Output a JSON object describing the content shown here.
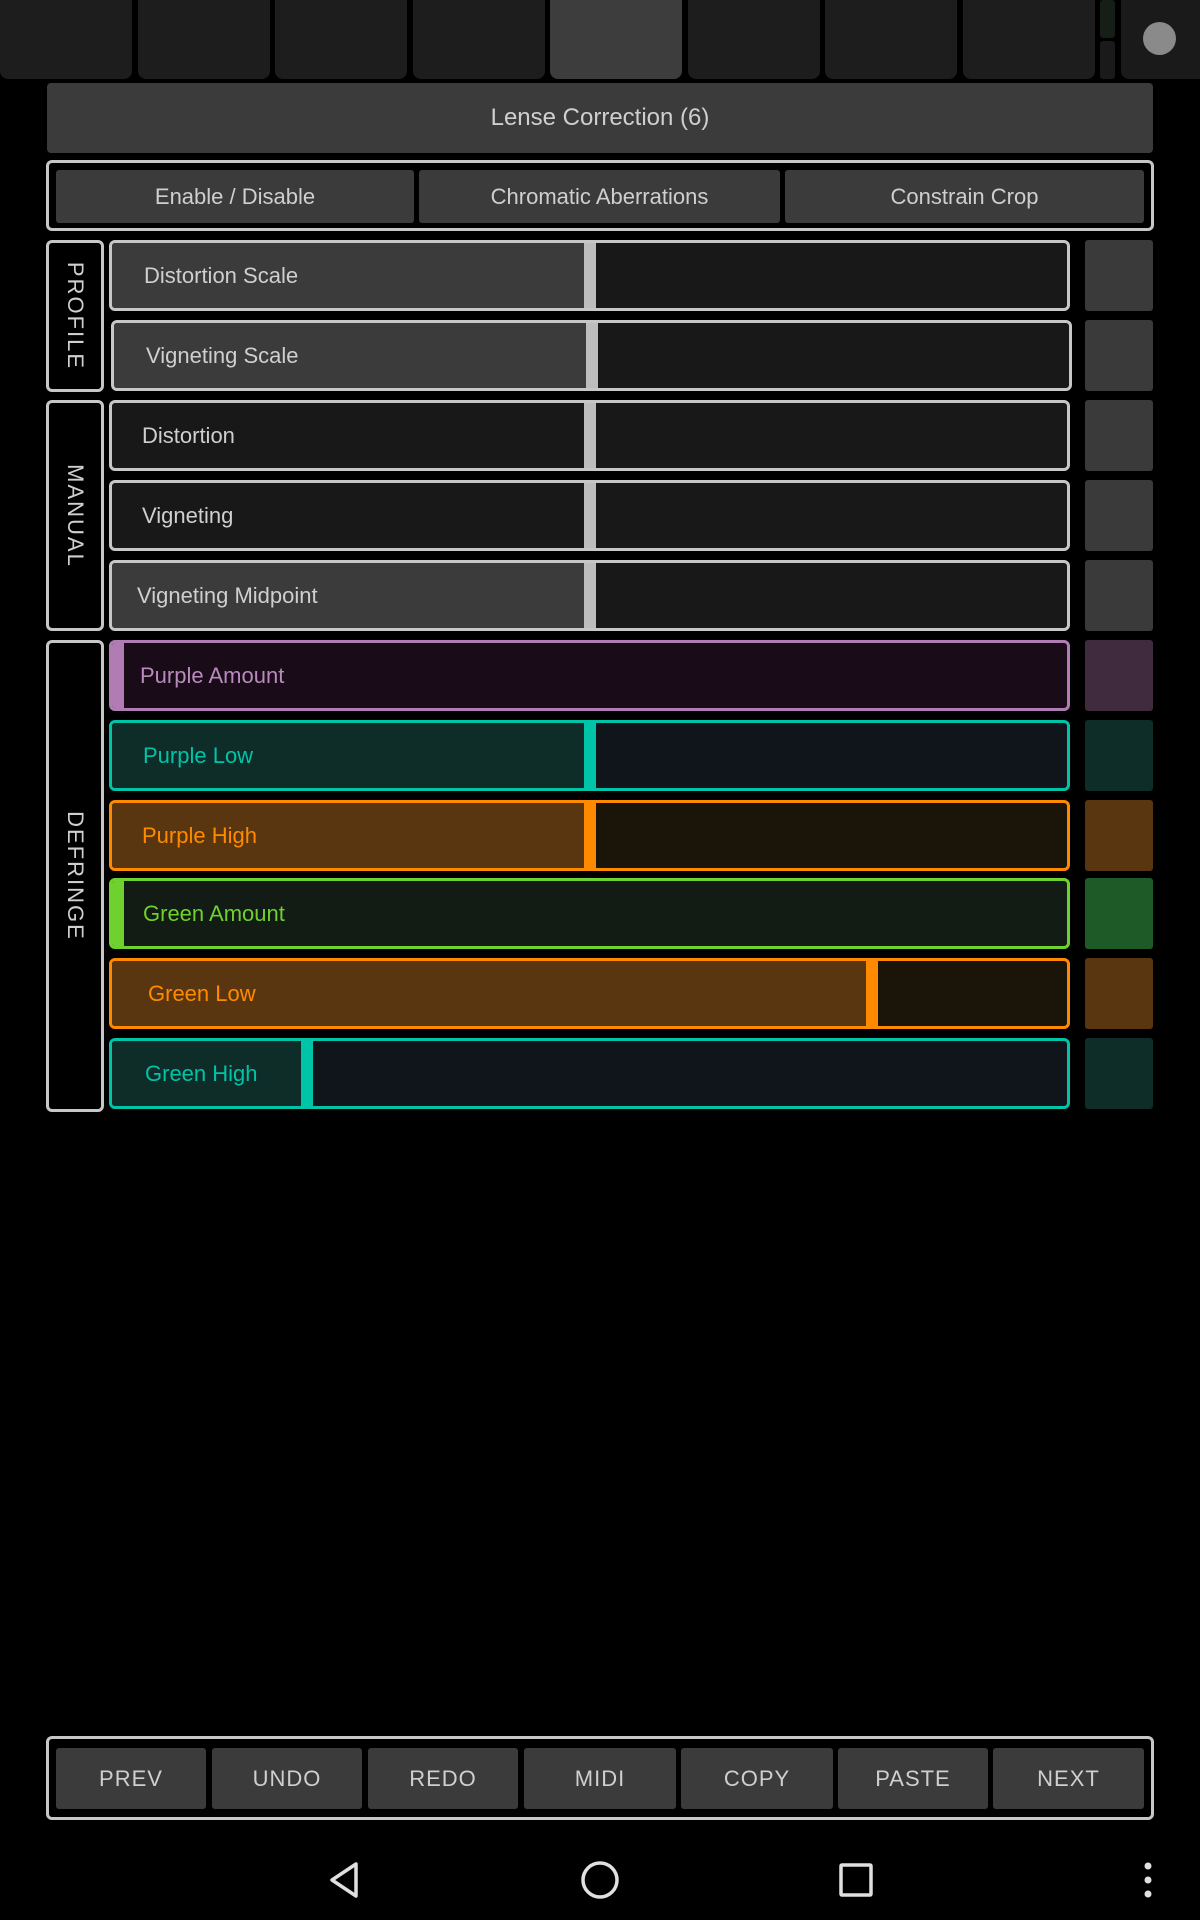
{
  "top_tabs": {
    "count": 8,
    "active_index": 4
  },
  "title": "Lense Correction (6)",
  "mode_buttons": [
    "Enable / Disable",
    "Chromatic Aberrations",
    "Constrain Crop"
  ],
  "groups": [
    {
      "label": "PROFILE"
    },
    {
      "label": "MANUAL"
    },
    {
      "label": "DEFRINGE"
    }
  ],
  "sliders": [
    {
      "label": "Distortion Scale",
      "value": 0.5,
      "theme": "gray",
      "filled": true,
      "swatch": "#3a3a3a"
    },
    {
      "label": "Vigneting Scale",
      "value": 0.5,
      "theme": "gray",
      "filled": true,
      "swatch": "#3a3a3a"
    },
    {
      "label": "Distortion",
      "value": 0.5,
      "theme": "gray",
      "filled": false,
      "swatch": "#3a3a3a"
    },
    {
      "label": "Vigneting",
      "value": 0.5,
      "theme": "gray",
      "filled": false,
      "swatch": "#3a3a3a"
    },
    {
      "label": "Vigneting Midpoint",
      "value": 0.5,
      "theme": "gray",
      "filled": true,
      "swatch": "#3a3a3a"
    },
    {
      "label": "Purple Amount",
      "value": 0.0,
      "theme": "purple",
      "filled": false,
      "swatch": "#3f2a3e"
    },
    {
      "label": "Purple Low",
      "value": 0.5,
      "theme": "teal",
      "filled": true,
      "swatch": "#0e2c28"
    },
    {
      "label": "Purple High",
      "value": 0.5,
      "theme": "orange",
      "filled": true,
      "swatch": "#5a3610"
    },
    {
      "label": "Green Amount",
      "value": 0.0,
      "theme": "green",
      "filled": false,
      "swatch": "#1d5a27"
    },
    {
      "label": "Green Low",
      "value": 0.8,
      "theme": "orange",
      "filled": true,
      "swatch": "#5a3610"
    },
    {
      "label": "Green High",
      "value": 0.2,
      "theme": "teal",
      "filled": true,
      "swatch": "#0e2c28"
    }
  ],
  "footer_buttons": [
    "PREV",
    "UNDO",
    "REDO",
    "MIDI",
    "COPY",
    "PASTE",
    "NEXT"
  ],
  "system_nav": [
    "back-icon",
    "home-icon",
    "recents-icon",
    "more-icon"
  ]
}
